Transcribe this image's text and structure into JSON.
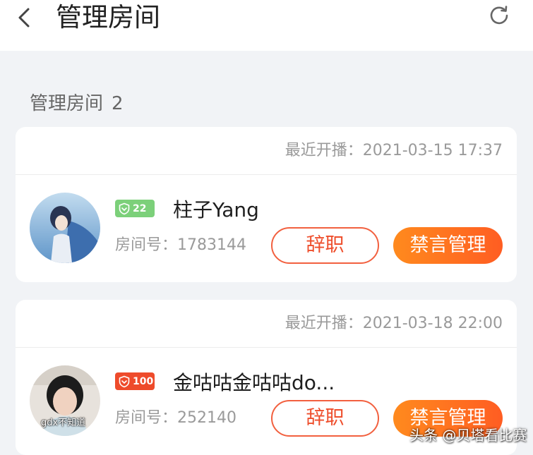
{
  "header": {
    "title": "管理房间",
    "back_icon": "chevron-left-icon",
    "refresh_icon": "refresh-icon"
  },
  "section": {
    "label": "管理房间",
    "count": "2"
  },
  "rooms": [
    {
      "last_live_label": "最近开播：",
      "last_live_time": "2021-03-15 17:37",
      "level": "22",
      "level_color": "#7cd07a",
      "level_icon": "shield-icon",
      "name": "柱子Yang",
      "room_label": "房间号：",
      "room_number": "1783144",
      "resign_label": "辞职",
      "mute_label": "禁言管理"
    },
    {
      "last_live_label": "最近开播：",
      "last_live_time": "2021-03-18 22:00",
      "avatar_caption": "gdx不知道",
      "level": "100",
      "level_color": "#ee4b2b",
      "level_icon": "shield-icon",
      "name": "金咕咕金咕咕do...",
      "room_label": "房间号：",
      "room_number": "252140",
      "resign_label": "辞职",
      "mute_label": "禁言管理"
    }
  ],
  "colors": {
    "page_bg": "#f1f3f6",
    "accent_start": "#ff8a1e",
    "accent_end": "#ff5d22",
    "outline": "#f2603f",
    "outline_text": "#ee4e2c"
  },
  "watermark": "头条 @贝塔看比赛"
}
